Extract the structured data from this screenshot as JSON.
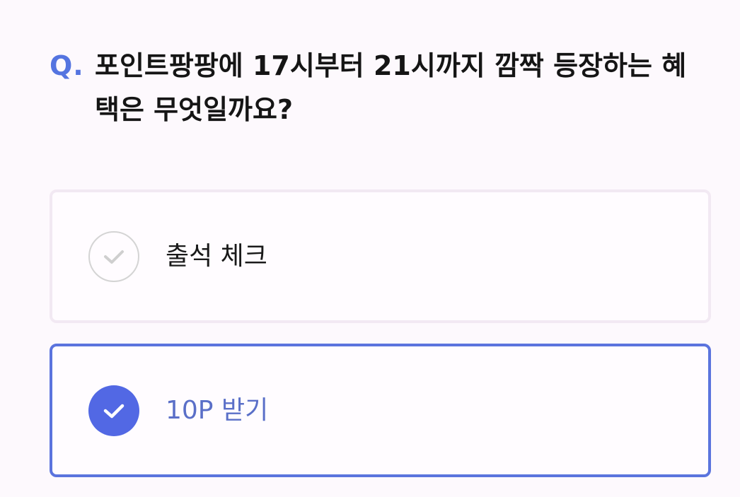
{
  "question": {
    "prefix": "Q.",
    "text": "포인트팡팡에 17시부터 21시까지 깜짝 등장하는 혜택은 무엇일까요?"
  },
  "options": [
    {
      "label": "출석 체크",
      "selected": false
    },
    {
      "label": "10P 받기",
      "selected": true
    }
  ],
  "colors": {
    "accent": "#5268e4",
    "selected_border": "#5b74de",
    "unselected_border": "#f2e9f3",
    "selected_text": "#5a6fc8",
    "background": "#fdf9fd"
  },
  "icons": {
    "unchecked": "check-icon",
    "checked": "check-icon"
  }
}
